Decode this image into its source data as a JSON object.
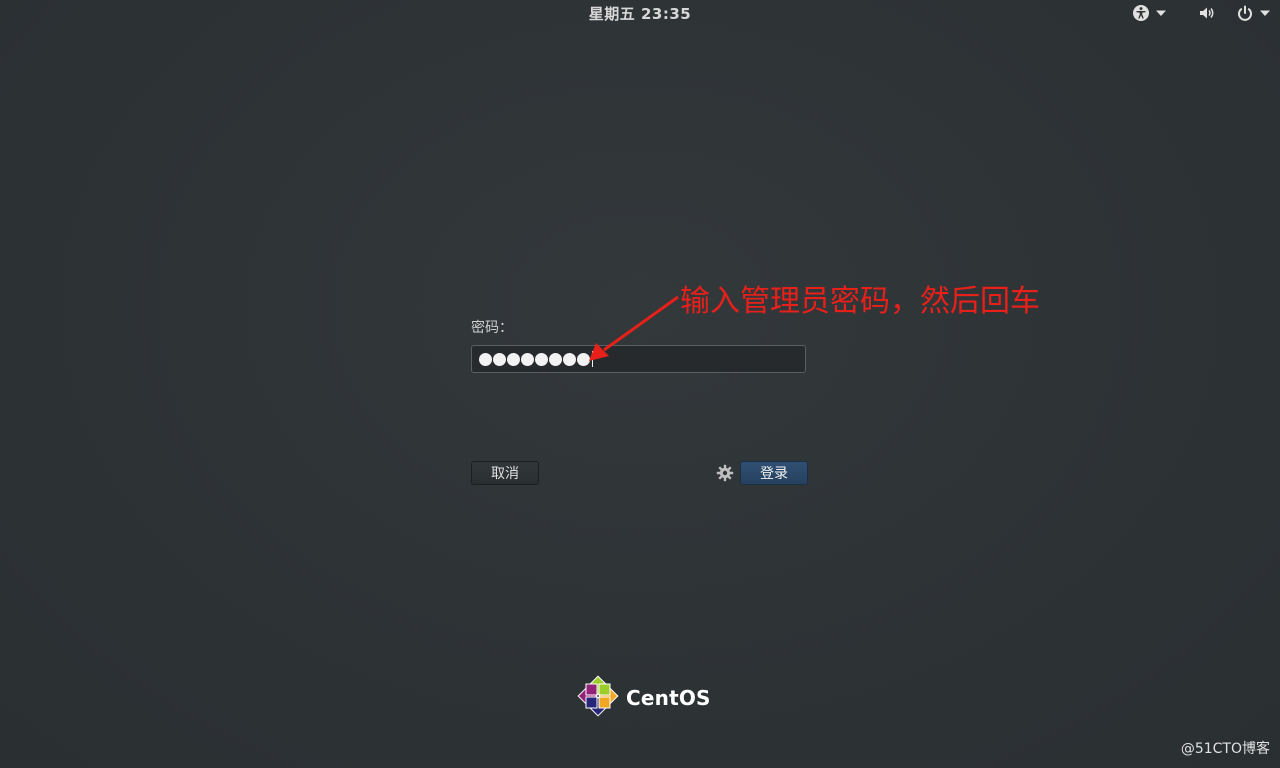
{
  "topbar": {
    "clock": "星期五 23:35",
    "accessibility_icon": "accessibility-icon",
    "volume_icon": "volume-icon",
    "power_icon": "power-icon",
    "dropdown_icon": "chevron-down-icon"
  },
  "login": {
    "password_label": "密码：",
    "password_dots": 8,
    "cancel_label": "取消",
    "login_label": "登录",
    "settings_icon": "gear-icon"
  },
  "annotation": {
    "text": "输入管理员密码，然后回车",
    "color": "#e8201a"
  },
  "branding": {
    "logo_text": "CentOS",
    "watermark": "@51CTO博客"
  },
  "colors": {
    "background": "#2e3436",
    "login_button": "#2f4f72",
    "annotation": "#e8201a"
  }
}
